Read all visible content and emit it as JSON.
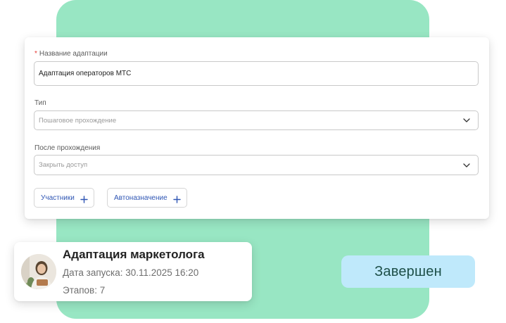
{
  "form": {
    "name_label": "Название адаптации",
    "name_value": "Адаптация операторов МТС",
    "type_label": "Тип",
    "type_placeholder": "Пошаговое прохождение",
    "after_label": "После прохождения",
    "after_placeholder": "Закрыть доступ",
    "participants_button": "Участники",
    "autoassign_button": "Автоназначение"
  },
  "course_card": {
    "title": "Адаптация маркетолога",
    "launch_date": "Дата запуска: 30.11.2025 16:20",
    "stages": "Этапов: 7"
  },
  "status": {
    "label": "Завершен"
  },
  "colors": {
    "backdrop": "#98e6c3",
    "status_bg": "#bfe9fb",
    "link_blue": "#2f56b4",
    "required_red": "#e53935"
  },
  "icons": {
    "dropdown": "chevron-down-icon",
    "add": "plus-icon"
  }
}
